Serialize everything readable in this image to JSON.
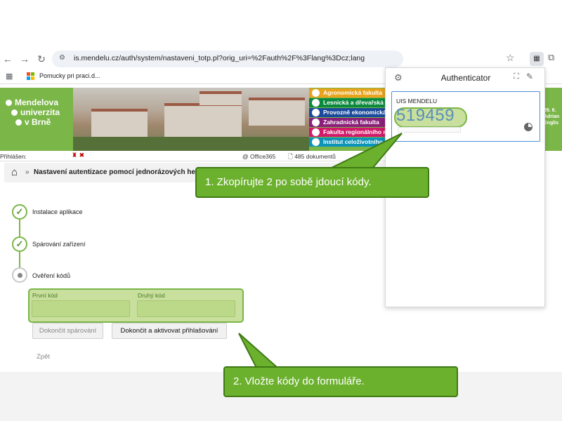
{
  "browser": {
    "url": "is.mendelu.cz/auth/system/nastaveni_totp.pl?orig_uri=%2Fauth%2F%3Flang%3Dcz;lang",
    "bookmark": "Pomucky pri praci.d..."
  },
  "banner": {
    "logo_lines": [
      "Mendelova",
      "univerzita",
      "v Brně"
    ],
    "faculties": [
      {
        "label": "Agronomická fakulta",
        "color": "#e8a21c"
      },
      {
        "label": "Lesnická a dřevařská fakulta",
        "color": "#0b8a3e"
      },
      {
        "label": "Provozně ekonomická fakulta",
        "color": "#1a4a9c"
      },
      {
        "label": "Zahradnická fakulta",
        "color": "#8a1f7a"
      },
      {
        "label": "Fakulta regionálního rozvoje",
        "color": "#d11a6a"
      },
      {
        "label": "Institut celoživotního",
        "color": "#0b93b8"
      }
    ],
    "right_lines": [
      "26. 6.",
      "Adrian",
      "",
      "Englis"
    ]
  },
  "info_bar": {
    "login_label": "Přihlášen:",
    "office": "Office365",
    "documents": "485 dokumentů"
  },
  "breadcrumb": {
    "title": "Nastavení autentizace pomocí jednorázových hesel (C"
  },
  "steps": [
    {
      "label": "Instalace aplikace",
      "done": true
    },
    {
      "label": "Spárování zařízení",
      "done": true
    },
    {
      "label": "Ověření kódů",
      "done": false
    }
  ],
  "form": {
    "first_code_label": "První kód",
    "second_code_label": "Druhý kód",
    "first_code_value": "",
    "second_code_value": "",
    "finish_pair_label": "Dokončit spárování",
    "finish_activate_label": "Dokončit a aktivovat přihlašování",
    "back_label": "Zpět"
  },
  "authenticator": {
    "title": "Authenticator",
    "issuer": "UIS MENDELU",
    "code": "519459"
  },
  "callouts": {
    "first": "1. Zkopírujte 2 po sobě jdoucí kódy.",
    "second": "2. Vložte kódy do formuláře."
  },
  "colors": {
    "brand_green": "#7ab648",
    "callout_green": "#6cb12e",
    "highlight_green": "#c8df9e"
  }
}
